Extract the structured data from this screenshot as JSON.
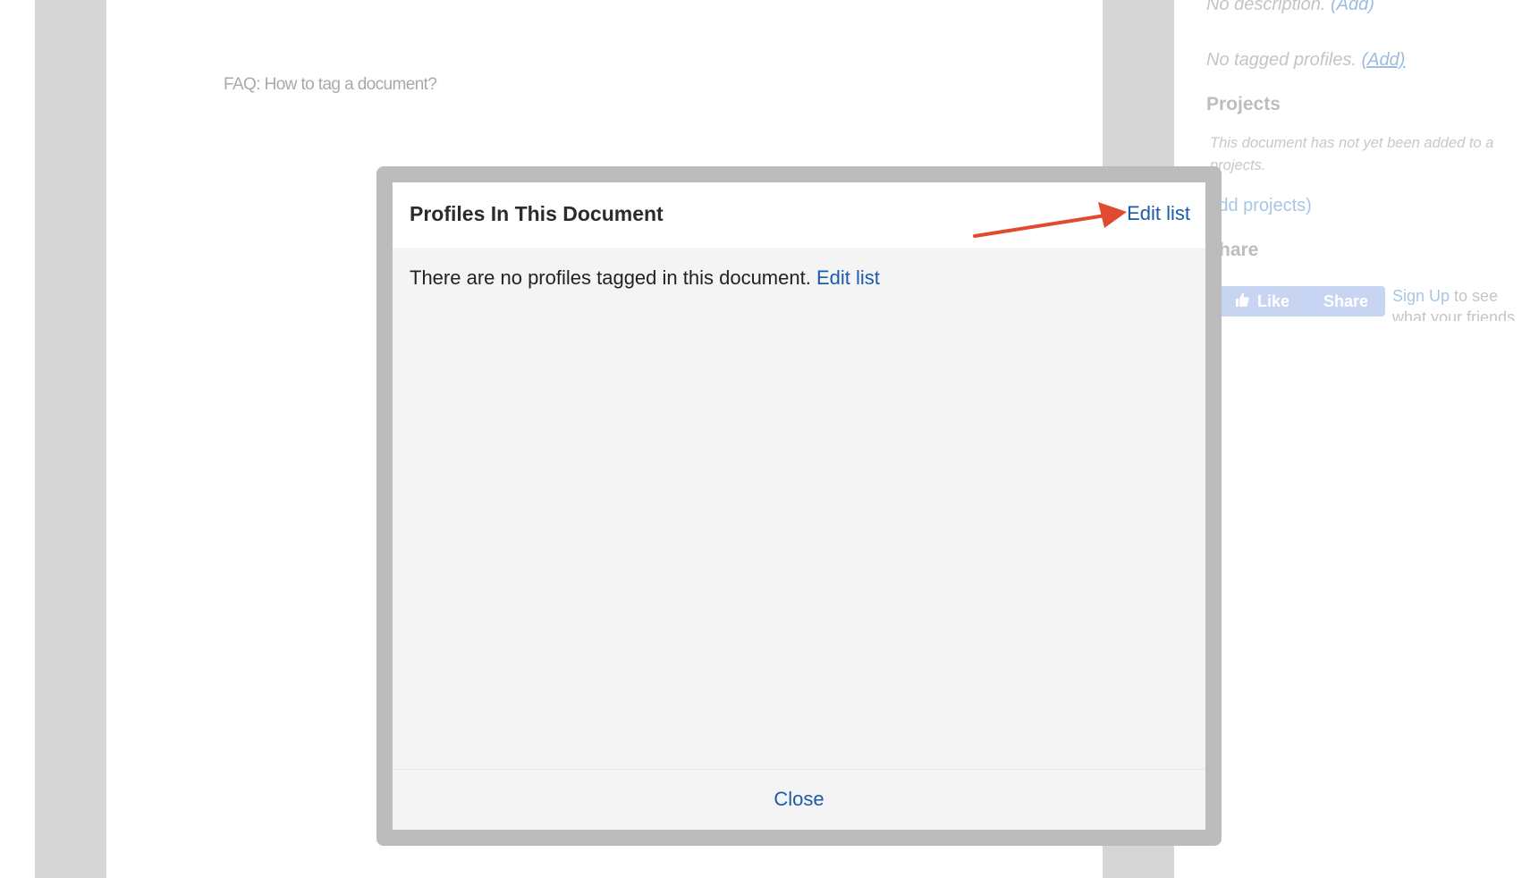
{
  "background": {
    "faq_link": "FAQ: How to tag a document?",
    "sidebar": {
      "no_description": "No description.",
      "no_description_add": "(Add)",
      "no_tagged_profiles": "No tagged profiles.",
      "no_tagged_profiles_add": "(Add)",
      "projects_heading": "Projects",
      "projects_note": "This document has not yet been added to a\nprojects.",
      "add_projects": "Add projects)",
      "share_heading": "Share",
      "like_label": "Like",
      "share_label": "Share",
      "signup_link": "Sign Up",
      "signup_text": " to see what your friends like."
    }
  },
  "modal": {
    "title": "Profiles In This Document",
    "header_edit_link": "Edit list",
    "empty_message": "There are no profiles tagged in this document.",
    "body_edit_link": "Edit list",
    "close_label": "Close"
  },
  "annotation": {
    "arrow_color": "#e04a2f",
    "icon": "arrow-pointer-icon"
  },
  "colors": {
    "link": "#1a5bac",
    "overlay_frame": "#bcbcbc",
    "modal_body_bg": "#f4f4f4"
  }
}
